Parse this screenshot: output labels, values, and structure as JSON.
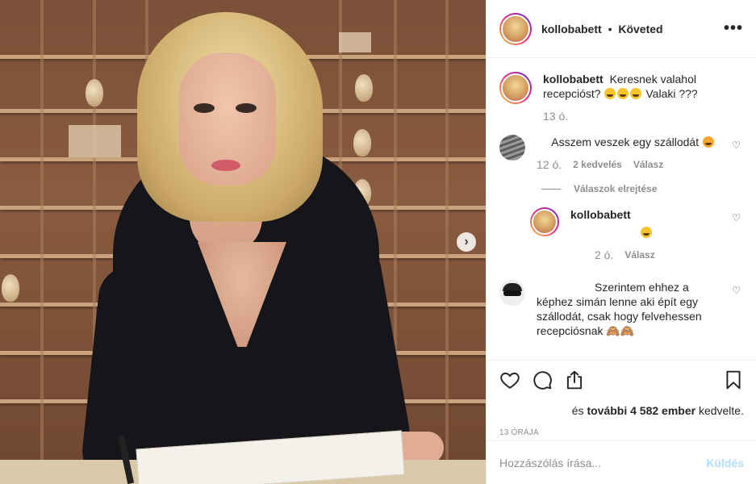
{
  "post": {
    "image_alt": ""
  },
  "header": {
    "username": "kollobabett",
    "separator": "•",
    "follow_status": "Követed",
    "more": "•••"
  },
  "caption": {
    "username": "kollobabett",
    "text": "Keresnek valahol recepcióst?",
    "text_after": "Valaki ???",
    "emoji_count": 3,
    "time": "13 ó."
  },
  "comments": [
    {
      "username": "",
      "text": "Asszem veszek egy szállodát",
      "time": "12 ó.",
      "likes": "2 kedvelés",
      "reply": "Válasz"
    },
    {
      "username": "kollobabett",
      "text": "",
      "time": "2 ó.",
      "reply": "Válasz"
    },
    {
      "username": "",
      "text": "Szerintem ehhez a képhez simán lenne aki épít egy szállodát, csak hogy felvehessen recepciósnak 🙈🙈"
    }
  ],
  "replies_toggle": "Válaszok elrejtése",
  "actions": {
    "likes_prefix": "és",
    "likes_count": "további 4 582 ember",
    "likes_suffix": "kedvelte.",
    "timestamp": "13 ÓRÁJA"
  },
  "comment_box": {
    "placeholder": "Hozzászólás írása...",
    "post_label": "Küldés"
  },
  "colors": {
    "accent": "#0095f6",
    "post_disabled": "#b2dffc",
    "text": "#262626",
    "muted": "#8e8e8e"
  }
}
